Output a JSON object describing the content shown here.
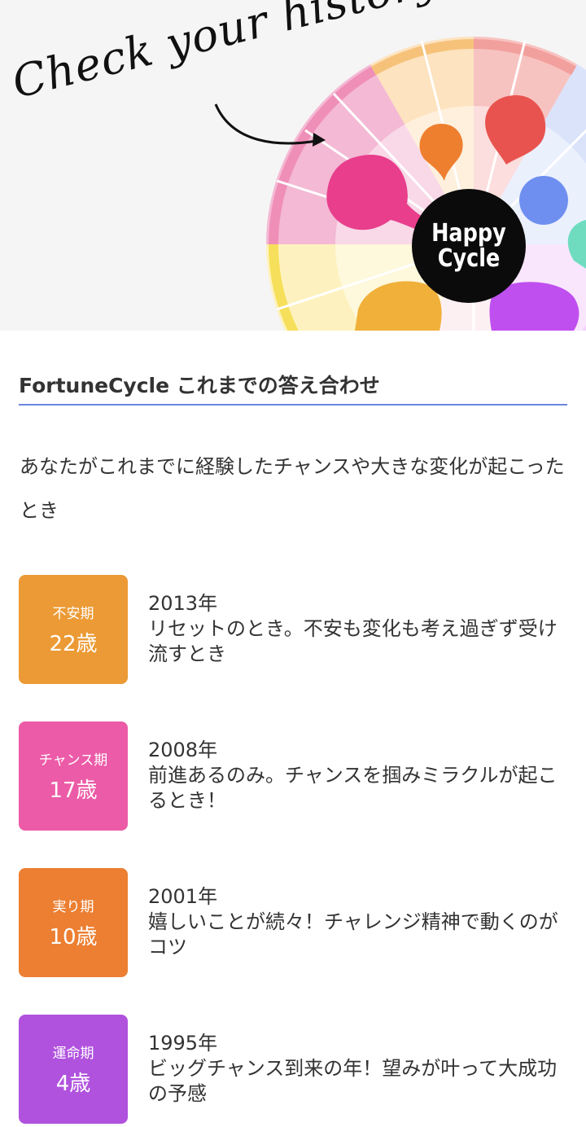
{
  "hero": {
    "headline": "Check your history!",
    "badge_line1": "Happy",
    "badge_line2": "Cycle",
    "colors": {
      "background": "#f5f5f5",
      "pink": "#e83e8c",
      "orange": "#ee7f2f",
      "red": "#e9534f",
      "blue": "#6f8ff0",
      "teal": "#6fdcc0",
      "yellow": "#f0b03a",
      "purple": "#c04fef"
    }
  },
  "section": {
    "title": "FortuneCycle これまでの答え合わせ",
    "accent_color": "#6c87de"
  },
  "intro": "あなたがこれまでに経験したチャンスや大きな変化が起こったとき",
  "history": [
    {
      "period": "不安期",
      "age": "22歳",
      "year": "2013年",
      "description": "リセットのとき。不安も変化も考え過ぎず受け流すとき",
      "color": "#ec9a35"
    },
    {
      "period": "チャンス期",
      "age": "17歳",
      "year": "2008年",
      "description": "前進あるのみ。チャンスを掴みミラクルが起こるとき！",
      "color": "#ec5ba7"
    },
    {
      "period": "実り期",
      "age": "10歳",
      "year": "2001年",
      "description": "嬉しいことが続々！チャレンジ精神で動くのがコツ",
      "color": "#ec7f32"
    },
    {
      "period": "運命期",
      "age": "4歳",
      "year": "1995年",
      "description": "ビッグチャンス到来の年！望みが叶って大成功の予感",
      "color": "#b052de"
    }
  ]
}
